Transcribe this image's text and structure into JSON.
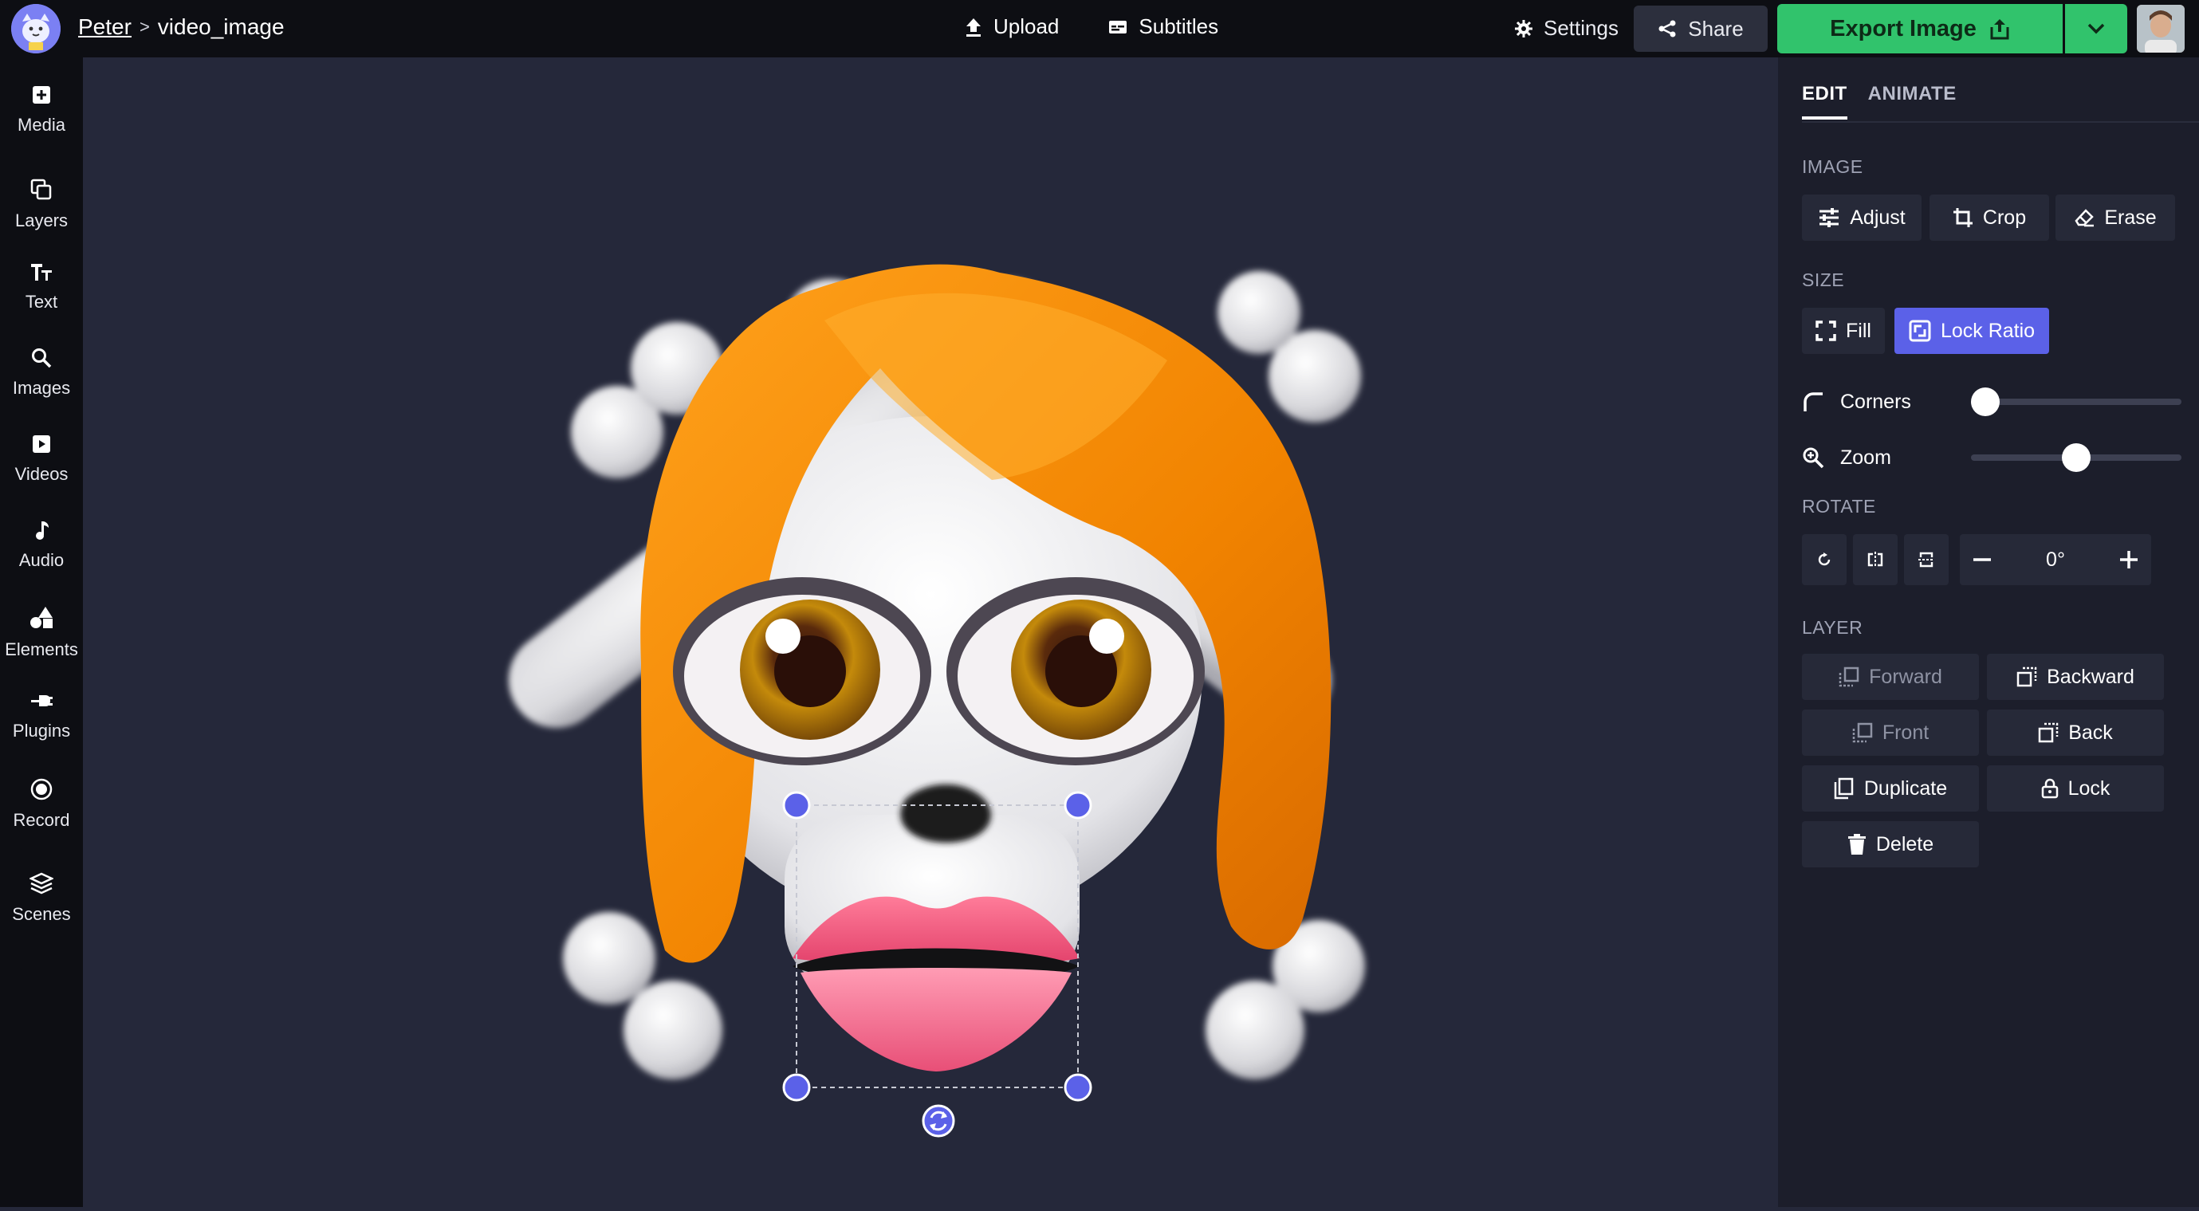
{
  "app": {
    "breadcrumb_user": "Peter",
    "breadcrumb_separator": ">",
    "project_name": "video_image"
  },
  "topbar": {
    "upload_label": "Upload",
    "subtitles_label": "Subtitles",
    "settings_label": "Settings",
    "share_label": "Share",
    "export_label": "Export Image"
  },
  "sidebar": {
    "items": [
      {
        "label": "Media",
        "icon": "media-icon"
      },
      {
        "label": "Layers",
        "icon": "layers-icon"
      },
      {
        "label": "Text",
        "icon": "text-icon"
      },
      {
        "label": "Images",
        "icon": "search-icon"
      },
      {
        "label": "Videos",
        "icon": "video-icon"
      },
      {
        "label": "Audio",
        "icon": "music-note-icon"
      },
      {
        "label": "Elements",
        "icon": "shapes-icon"
      },
      {
        "label": "Plugins",
        "icon": "plug-icon"
      },
      {
        "label": "Record",
        "icon": "record-icon"
      },
      {
        "label": "Scenes",
        "icon": "stack-icon"
      }
    ]
  },
  "panel": {
    "tabs": [
      {
        "label": "EDIT",
        "active": true
      },
      {
        "label": "ANIMATE",
        "active": false
      }
    ],
    "image_section": "IMAGE",
    "image_buttons": {
      "adjust": "Adjust",
      "crop": "Crop",
      "erase": "Erase"
    },
    "size_section": "SIZE",
    "size_buttons": {
      "fill": "Fill",
      "lock_ratio": "Lock Ratio"
    },
    "corners_label": "Corners",
    "corners_value": 0,
    "zoom_label": "Zoom",
    "zoom_value": 0.5,
    "rotate_section": "ROTATE",
    "rotate_value": "0°",
    "layer_section": "LAYER",
    "layer_buttons": {
      "forward": "Forward",
      "backward": "Backward",
      "front": "Front",
      "back": "Back",
      "duplicate": "Duplicate",
      "lock": "Lock",
      "delete": "Delete"
    }
  },
  "colors": {
    "accent": "#5b61e8",
    "export_green": "#31c36c",
    "canvas_bg": "#25283a",
    "panel_bg": "#1c1e2b"
  }
}
